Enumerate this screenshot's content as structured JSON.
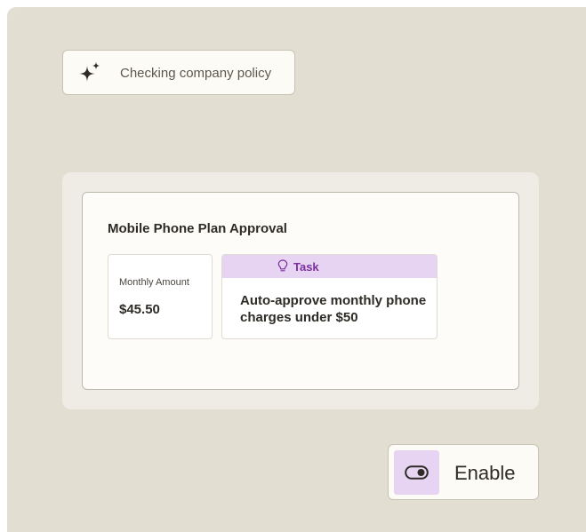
{
  "status": {
    "icon": "sparkle-icon",
    "text": "Checking company policy"
  },
  "card": {
    "title": "Mobile Phone Plan Approval",
    "amount": {
      "label": "Monthly Amount",
      "value": "$45.50"
    },
    "task": {
      "icon": "lightbulb-icon",
      "label": "Task",
      "text": "Auto-approve monthly phone charges under $50"
    }
  },
  "action": {
    "icon": "toggle-icon",
    "label": "Enable"
  },
  "colors": {
    "background": "#e3ded2",
    "accent_purple": "#e7d4f3",
    "task_text_purple": "#7a2f9c",
    "text_dark": "#2f2b26"
  }
}
